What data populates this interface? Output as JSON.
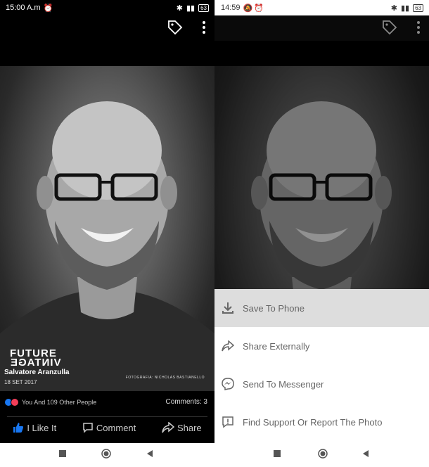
{
  "left": {
    "status": {
      "time": "15:00 A.m",
      "battery": "63"
    },
    "photo": {
      "logo_line1": "FUTURE",
      "logo_line2": "VINTAGE",
      "owner": "Salvatore Aranzulla",
      "date": "18 SET 2017",
      "credit": "FOTOGRAFIA: NICHOLAS BASTIANELLO"
    },
    "reactions_text": "You And 109 Other People",
    "comments_text": "Comments: 3",
    "actions": {
      "like": "I Like It",
      "comment": "Comment",
      "share": "Share"
    }
  },
  "right": {
    "status": {
      "time": "14:59",
      "battery": "63"
    },
    "sheet": {
      "items": [
        {
          "label": "Save To Phone",
          "icon": "download-icon"
        },
        {
          "label": "Share Externally",
          "icon": "share-icon"
        },
        {
          "label": "Send To Messenger",
          "icon": "messenger-icon"
        },
        {
          "label": "Find Support Or Report The Photo",
          "icon": "report-icon"
        }
      ]
    }
  },
  "colors": {
    "like_blue": "#1877f2",
    "love_red": "#f33e58"
  }
}
